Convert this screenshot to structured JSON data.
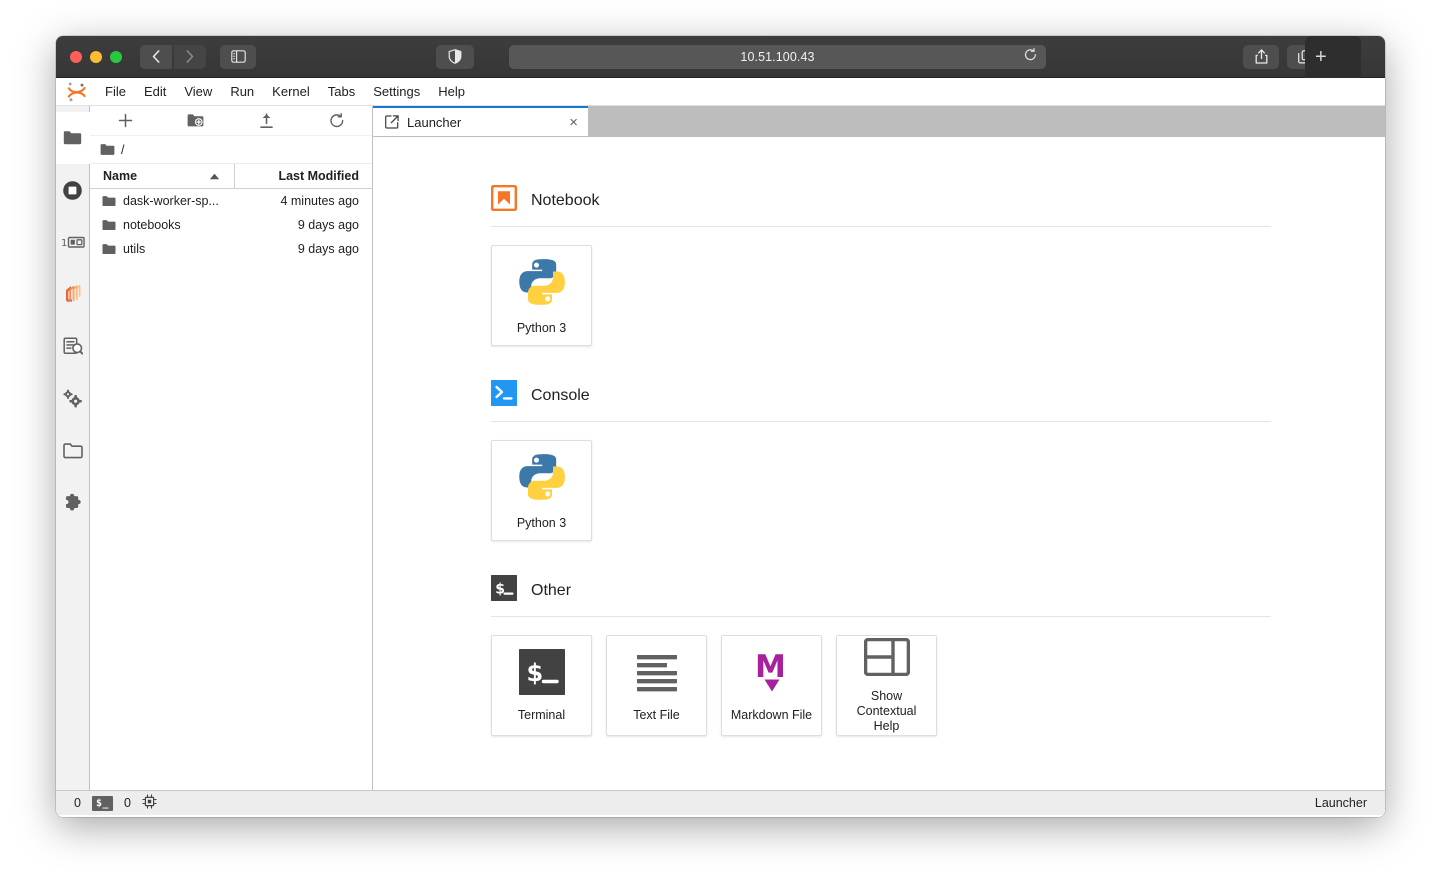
{
  "browser": {
    "url": "10.51.100.43",
    "back_icon": "chevron-left-icon",
    "forward_icon": "chevron-right-icon",
    "sidebar_icon": "sidebar-toggle-icon",
    "shield_icon": "privacy-shield-icon",
    "reload_icon": "reload-icon",
    "share_icon": "share-icon",
    "tabs_overview_icon": "tab-overview-icon",
    "new_tab_label": "+"
  },
  "menubar": {
    "logo": "jupyter-logo",
    "items": [
      {
        "label": "File"
      },
      {
        "label": "Edit"
      },
      {
        "label": "View"
      },
      {
        "label": "Run"
      },
      {
        "label": "Kernel"
      },
      {
        "label": "Tabs"
      },
      {
        "label": "Settings"
      },
      {
        "label": "Help"
      }
    ]
  },
  "activity_bar": {
    "items": [
      {
        "name": "file-browser",
        "icon": "folder-icon",
        "active": true
      },
      {
        "name": "running-sessions",
        "icon": "stop-circle-icon",
        "active": false
      },
      {
        "name": "command-palette",
        "icon": "command-palette-icon",
        "active": false
      },
      {
        "name": "dask",
        "icon": "dask-logo-icon",
        "active": false
      },
      {
        "name": "property-inspector",
        "icon": "property-inspector-icon",
        "active": false
      },
      {
        "name": "extension-settings",
        "icon": "gears-icon",
        "active": false
      },
      {
        "name": "open-tabs",
        "icon": "tabs-folder-icon",
        "active": false
      },
      {
        "name": "extension-manager",
        "icon": "puzzle-piece-icon",
        "active": false
      }
    ]
  },
  "file_browser": {
    "toolbar": [
      {
        "name": "new-launcher",
        "icon": "plus-icon"
      },
      {
        "name": "new-folder",
        "icon": "new-folder-icon"
      },
      {
        "name": "upload",
        "icon": "upload-icon"
      },
      {
        "name": "refresh",
        "icon": "refresh-icon"
      }
    ],
    "breadcrumb": {
      "icon": "folder-icon",
      "path": "/"
    },
    "columns": {
      "name": "Name",
      "last_modified": "Last Modified",
      "sort_caret": "caret-up-icon"
    },
    "rows": [
      {
        "icon": "folder-icon",
        "name": "dask-worker-sp...",
        "modified": "4 minutes ago"
      },
      {
        "icon": "folder-icon",
        "name": "notebooks",
        "modified": "9 days ago"
      },
      {
        "icon": "folder-icon",
        "name": "utils",
        "modified": "9 days ago"
      }
    ]
  },
  "dock": {
    "tabs": [
      {
        "label": "Launcher",
        "icon": "launcher-icon",
        "close_icon": "×",
        "active": true
      }
    ]
  },
  "launcher": {
    "sections": [
      {
        "title": "Notebook",
        "icon": "notebook-icon",
        "cards": [
          {
            "label": "Python 3",
            "icon": "python-logo-icon"
          }
        ]
      },
      {
        "title": "Console",
        "icon": "console-icon",
        "cards": [
          {
            "label": "Python 3",
            "icon": "python-logo-icon"
          }
        ]
      },
      {
        "title": "Other",
        "icon": "terminal-icon",
        "cards": [
          {
            "label": "Terminal",
            "icon": "terminal-icon"
          },
          {
            "label": "Text File",
            "icon": "text-file-icon"
          },
          {
            "label": "Markdown File",
            "icon": "markdown-icon"
          },
          {
            "label": "Show\nContextual Help",
            "icon": "contextual-help-icon"
          }
        ]
      }
    ]
  },
  "status_bar": {
    "kernel_count": "0",
    "terminal_badge": "$_",
    "terminal_count": "0",
    "resource_icon": "cpu-chip-icon",
    "right_label": "Launcher"
  },
  "colors": {
    "accent_blue": "#1976d2",
    "jupyter_orange": "#f37726",
    "console_blue": "#2196f3",
    "markdown_purple": "#a6219b",
    "python_blue": "#3c78a8",
    "python_yellow": "#ffd140",
    "dark_square": "#424242"
  }
}
